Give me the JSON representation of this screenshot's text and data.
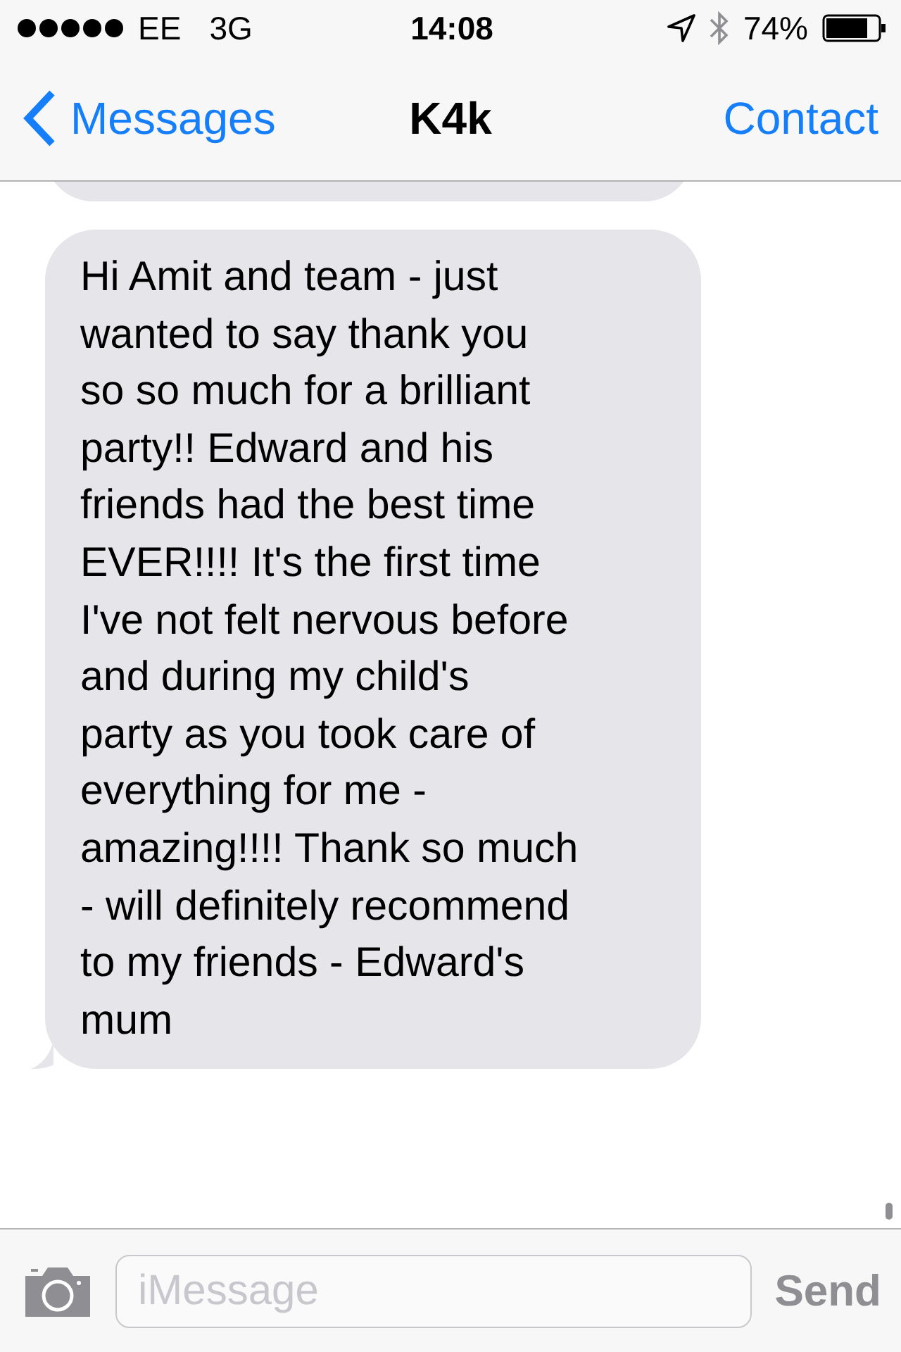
{
  "status_bar": {
    "carrier": "EE",
    "network": "3G",
    "time": "14:08",
    "battery": "74%"
  },
  "nav": {
    "back": "Messages",
    "title": "K4k",
    "action": "Contact"
  },
  "messages": [
    {
      "kind": "partial"
    },
    {
      "kind": "incoming",
      "lines": [
        "Hi Amit and team - just",
        "wanted to say thank you",
        "so so much for a brilliant",
        "party!! Edward and his",
        "friends had the best time",
        "EVER!!!! It's the first time",
        "I've not felt nervous before",
        "and during my child's",
        "party as you took care of",
        "everything for me -",
        "amazing!!!! Thank so much",
        "- will definitely recommend",
        "to my friends - Edward's",
        "mum"
      ]
    }
  ],
  "composer": {
    "placeholder": "iMessage",
    "send": "Send",
    "send_disabled": true
  }
}
